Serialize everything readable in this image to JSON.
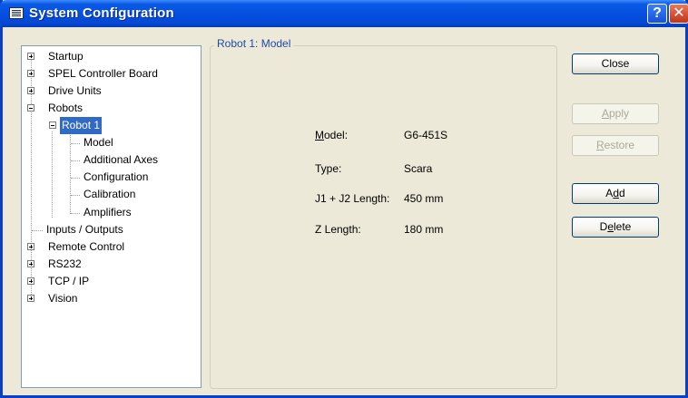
{
  "window": {
    "title": "System Configuration",
    "help_glyph": "?",
    "close_glyph": "✕"
  },
  "tree": {
    "items": [
      {
        "label": "Startup",
        "expander": "plus"
      },
      {
        "label": "SPEL Controller Board",
        "expander": "plus"
      },
      {
        "label": "Drive Units",
        "expander": "plus"
      },
      {
        "label": "Robots",
        "expander": "minus"
      },
      {
        "label": "Robot 1",
        "expander": "minus",
        "selected": true
      },
      {
        "label": "Model"
      },
      {
        "label": "Additional Axes"
      },
      {
        "label": "Configuration"
      },
      {
        "label": "Calibration"
      },
      {
        "label": "Amplifiers"
      },
      {
        "label": "Inputs / Outputs"
      },
      {
        "label": "Remote Control",
        "expander": "plus"
      },
      {
        "label": "RS232",
        "expander": "plus"
      },
      {
        "label": "TCP / IP",
        "expander": "plus"
      },
      {
        "label": "Vision",
        "expander": "plus"
      }
    ]
  },
  "panel": {
    "title": "Robot 1: Model",
    "fields": [
      {
        "label_pre": "",
        "label_ul": "M",
        "label_post": "odel:",
        "value": "G6-451S"
      },
      {
        "label_pre": "Type:",
        "label_ul": "",
        "label_post": "",
        "value": "Scara"
      },
      {
        "label_pre": "J1 + J2 Length:",
        "label_ul": "",
        "label_post": "",
        "value": "450 mm"
      },
      {
        "label_pre": "Z Length:",
        "label_ul": "",
        "label_post": "",
        "value": "180 mm"
      }
    ]
  },
  "buttons": {
    "close": {
      "pre": "Close",
      "ul": "",
      "post": "",
      "enabled": true
    },
    "apply": {
      "pre": "",
      "ul": "A",
      "post": "pply",
      "enabled": false
    },
    "restore": {
      "pre": "",
      "ul": "R",
      "post": "estore",
      "enabled": false
    },
    "add": {
      "pre": "A",
      "ul": "d",
      "post": "d",
      "enabled": true
    },
    "delete": {
      "pre": "D",
      "ul": "e",
      "post": "lete",
      "enabled": true
    }
  }
}
